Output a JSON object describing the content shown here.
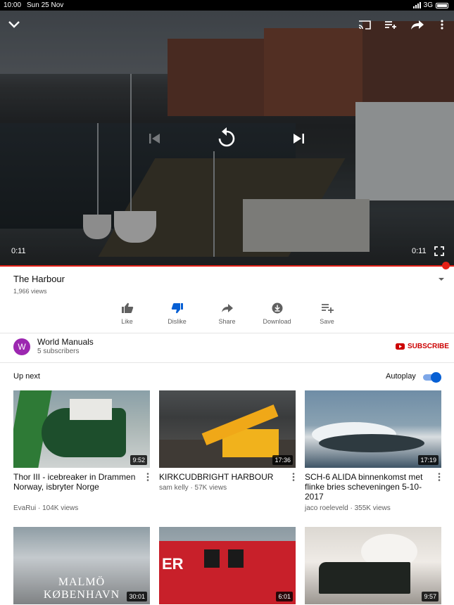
{
  "status_bar": {
    "time": "10:00",
    "date": "Sun 25 Nov",
    "network": "3G"
  },
  "player": {
    "elapsed": "0:11",
    "duration": "0:11",
    "progress": 1.0
  },
  "video": {
    "title": "The Harbour",
    "views": "1,966 views"
  },
  "actions": [
    {
      "label": "Like",
      "icon": "thumbs-up-icon"
    },
    {
      "label": "Dislike",
      "icon": "thumbs-down-icon"
    },
    {
      "label": "Share",
      "icon": "share-icon"
    },
    {
      "label": "Download",
      "icon": "download-icon"
    },
    {
      "label": "Save",
      "icon": "playlist-add-icon"
    }
  ],
  "channel": {
    "initial": "W",
    "name": "World Manuals",
    "subscribers": "5 subscribers",
    "subscribe_label": "SUBSCRIBE"
  },
  "up_next": {
    "heading": "Up next",
    "autoplay_label": "Autoplay",
    "autoplay_on": true
  },
  "videos": [
    {
      "title": "Thor III - icebreaker in Drammen Norway, isbryter Norge",
      "meta": "EvaRui · 104K views",
      "duration": "9:52"
    },
    {
      "title": "KIRKCUDBRIGHT  HARBOUR",
      "meta": "sam kelly · 57K views",
      "duration": "17:36"
    },
    {
      "title": "SCH-6 ALIDA binnenkomst met flinke bries scheveningen 5-10-2017",
      "meta": "jaco roeleveld · 355K views",
      "duration": "17:19"
    },
    {
      "thumb_text": [
        "MALMÖ",
        "KØBENHAVN"
      ],
      "duration": "30:01"
    },
    {
      "thumb_text": [
        "ER"
      ],
      "duration": "6:01"
    },
    {
      "duration": "9:57"
    }
  ],
  "colors": {
    "accent_red": "#e62117",
    "subscribe_red": "#cc0000",
    "toggle_blue": "#065fd4",
    "dislike_active": "#065fd4"
  }
}
